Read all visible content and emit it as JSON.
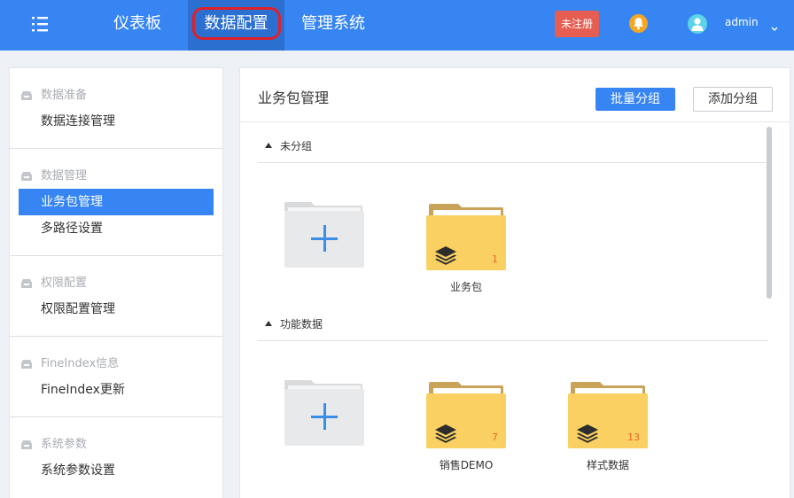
{
  "header": {
    "nav": {
      "dashboard": "仪表板",
      "data_config": "数据配置",
      "admin_system": "管理系统"
    },
    "unregistered_badge": "未注册",
    "username": "admin",
    "icons": [
      "menu-icon",
      "bell-icon",
      "user-icon",
      "chevron-down-icon"
    ]
  },
  "sidebar": {
    "groups": [
      {
        "label": "数据准备",
        "items": [
          "数据连接管理"
        ]
      },
      {
        "label": "数据管理",
        "items": [
          "业务包管理",
          "多路径设置"
        ]
      },
      {
        "label": "权限配置",
        "items": [
          "权限配置管理"
        ]
      },
      {
        "label": "FineIndex信息",
        "items": [
          "FineIndex更新"
        ]
      },
      {
        "label": "系统参数",
        "items": [
          "系统参数设置"
        ]
      }
    ],
    "active_item": "业务包管理"
  },
  "main": {
    "title": "业务包管理",
    "batch_group_button": "批量分组",
    "add_group_button": "添加分组",
    "sections": [
      {
        "label": "未分组",
        "packages": [
          {
            "name": "业务包",
            "count": "1"
          }
        ]
      },
      {
        "label": "功能数据",
        "packages": [
          {
            "name": "销售DEMO",
            "count": "7"
          },
          {
            "name": "样式数据",
            "count": "13"
          }
        ]
      }
    ]
  },
  "colors": {
    "primary": "#3685f2",
    "active_nav": "#2b6fd0",
    "highlight_outline": "#e0202a",
    "unregistered_badge": "#e65e52",
    "folder_yellow": "#f9d061",
    "folder_tab": "#c9a35a",
    "count_orange": "#e96a2f"
  }
}
